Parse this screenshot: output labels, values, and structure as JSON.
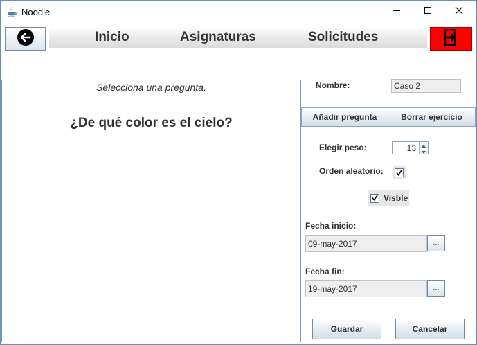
{
  "window": {
    "title": "Noodle",
    "icons": {
      "app": "java-cup-icon",
      "minimize": "minimize-icon",
      "maximize": "maximize-icon",
      "close": "close-icon"
    }
  },
  "nav": {
    "back_icon": "arrow-left-circle-icon",
    "links": [
      "Inicio",
      "Asignaturas",
      "Solicitudes"
    ],
    "exit_icon": "exit-door-icon",
    "exit_color": "#ff0000"
  },
  "questions": {
    "hint": "Selecciona una pregunta.",
    "items": [
      "¿De qué color es el cielo?"
    ]
  },
  "form": {
    "name_label": "Nombre:",
    "name_value": "Caso 2",
    "add_question_label": "Añadir pregunta",
    "delete_exercise_label": "Borrar ejercicio",
    "weight_label": "Elegir peso:",
    "weight_value": "13",
    "random_order_label": "Orden aleatorio:",
    "random_order_checked": true,
    "visible_label": "Visble",
    "visible_checked": true,
    "start_date_label": "Fecha inicio:",
    "start_date_value": "09-may-2017",
    "end_date_label": "Fecha fin:",
    "end_date_value": "19-may-2017",
    "picker_label": "...",
    "save_label": "Guardar",
    "cancel_label": "Cancelar"
  }
}
